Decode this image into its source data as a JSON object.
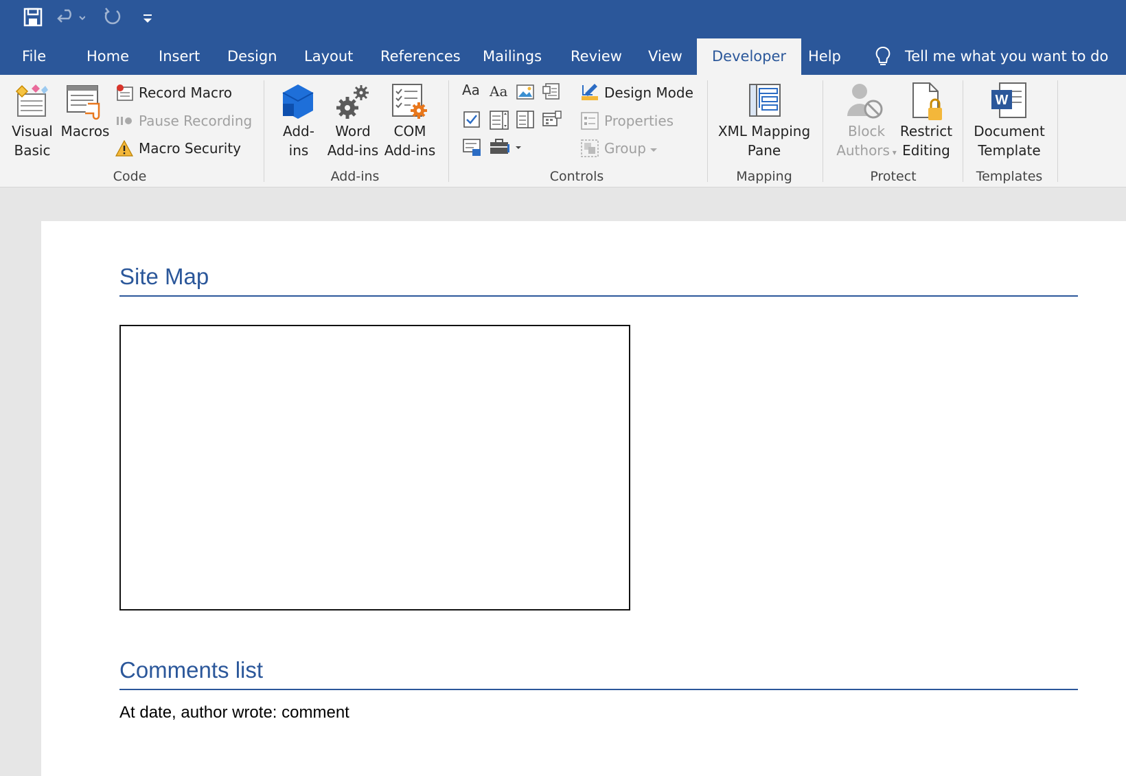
{
  "quick_access": {
    "icons": [
      "save-icon",
      "undo-icon",
      "redo-icon",
      "customize-qat-icon"
    ]
  },
  "tabs": [
    {
      "label": "File"
    },
    {
      "label": "Home"
    },
    {
      "label": "Insert"
    },
    {
      "label": "Design"
    },
    {
      "label": "Layout"
    },
    {
      "label": "References"
    },
    {
      "label": "Mailings"
    },
    {
      "label": "Review"
    },
    {
      "label": "View"
    },
    {
      "label": "Developer"
    },
    {
      "label": "Help"
    }
  ],
  "active_tab": "Developer",
  "tell_me": {
    "label": "Tell me what you want to do"
  },
  "ribbon": {
    "code": {
      "group_label": "Code",
      "visual_basic": [
        "Visual",
        "Basic"
      ],
      "macros": "Macros",
      "record_macro": "Record Macro",
      "pause_recording": "Pause Recording",
      "macro_security": "Macro Security"
    },
    "addins": {
      "group_label": "Add-ins",
      "addins": [
        "Add-",
        "ins"
      ],
      "word_addins": [
        "Word",
        "Add-ins"
      ],
      "com_addins": [
        "COM",
        "Add-ins"
      ]
    },
    "controls": {
      "group_label": "Controls",
      "design_mode": "Design Mode",
      "properties": "Properties",
      "group": "Group",
      "rich_text_glyph": "Aa",
      "plain_text_glyph": "Aa"
    },
    "mapping": {
      "group_label": "Mapping",
      "xml_mapping": [
        "XML Mapping",
        "Pane"
      ]
    },
    "protect": {
      "group_label": "Protect",
      "block_authors": [
        "Block",
        "Authors"
      ],
      "restrict_editing": [
        "Restrict",
        "Editing"
      ]
    },
    "templates": {
      "group_label": "Templates",
      "document_template": [
        "Document",
        "Template"
      ]
    }
  },
  "document": {
    "heading1": "Site Map",
    "heading2": "Comments list",
    "comment_text": "At date, author wrote: comment"
  },
  "colors": {
    "brand": "#2b579a",
    "ribbon_bg": "#f3f3f3",
    "disabled_text": "#a0a0a0"
  }
}
